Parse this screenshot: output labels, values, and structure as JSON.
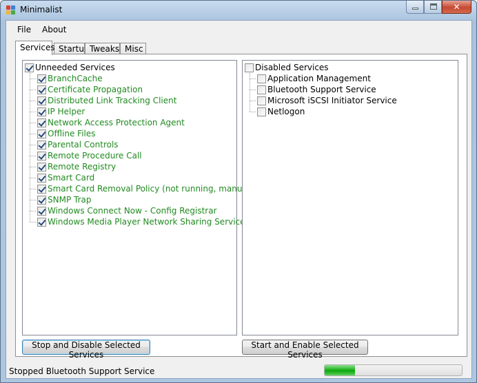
{
  "window": {
    "title": "Minimalist"
  },
  "menu": [
    "File",
    "About"
  ],
  "tabs": [
    "Services",
    "Startup",
    "Tweaks",
    "Misc"
  ],
  "left_tree": {
    "root": {
      "label": "Unneeded Services",
      "checked": true
    },
    "items": [
      {
        "label": "BranchCache",
        "checked": true
      },
      {
        "label": "Certificate Propagation",
        "checked": true
      },
      {
        "label": "Distributed Link Tracking Client",
        "checked": true
      },
      {
        "label": "IP Helper",
        "checked": true
      },
      {
        "label": "Network Access Protection Agent",
        "checked": true
      },
      {
        "label": "Offline Files",
        "checked": true
      },
      {
        "label": "Parental Controls",
        "checked": true
      },
      {
        "label": "Remote Procedure Call",
        "checked": true
      },
      {
        "label": "Remote Registry",
        "checked": true
      },
      {
        "label": "Smart Card",
        "checked": true
      },
      {
        "label": "Smart Card Removal Policy  (not running, manual)",
        "checked": true
      },
      {
        "label": "SNMP Trap",
        "checked": true
      },
      {
        "label": "Windows Connect Now - Config Registrar",
        "checked": true
      },
      {
        "label": "Windows Media Player Network Sharing Service",
        "checked": true
      }
    ]
  },
  "right_tree": {
    "root": {
      "label": "Disabled Services",
      "checked": false
    },
    "items": [
      {
        "label": "Application Management",
        "checked": false
      },
      {
        "label": "Bluetooth Support Service",
        "checked": false
      },
      {
        "label": "Microsoft iSCSI Initiator Service",
        "checked": false
      },
      {
        "label": "Netlogon",
        "checked": false
      }
    ]
  },
  "buttons": {
    "stop_disable": "Stop and Disable Selected Services",
    "start_enable": "Start and Enable Selected Services"
  },
  "status": {
    "text": "Stopped Bluetooth Support Service",
    "progress": 0.22
  },
  "colors": {
    "unneeded_item_text": "#218a21",
    "progress_fill": "#22b322"
  }
}
